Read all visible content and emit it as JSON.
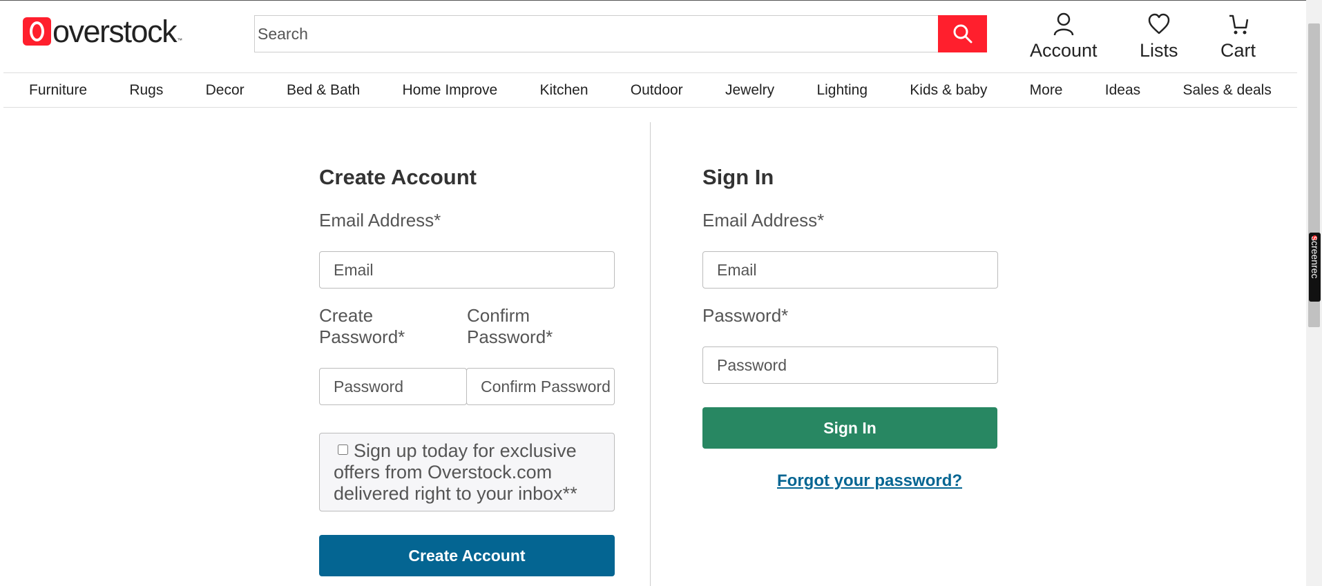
{
  "brand": {
    "logo_text": "overstock",
    "logo_tm": "™",
    "accent_color": "#ff1f2d"
  },
  "search": {
    "placeholder": "Search"
  },
  "header_links": {
    "account": "Account",
    "lists": "Lists",
    "cart": "Cart"
  },
  "nav": {
    "items": [
      "Furniture",
      "Rugs",
      "Decor",
      "Bed & Bath",
      "Home Improve",
      "Kitchen",
      "Outdoor",
      "Jewelry",
      "Lighting",
      "Kids & baby",
      "More",
      "Ideas",
      "Sales & deals"
    ]
  },
  "create_account": {
    "title": "Create Account",
    "email_label": "Email Address*",
    "email_placeholder": "Email",
    "password_label_line1": "Create",
    "password_label_line2": "Password*",
    "confirm_label_line1": "Confirm",
    "confirm_label_line2": "Password*",
    "password_placeholder": "Password",
    "confirm_placeholder": "Confirm Password",
    "optin_text": "Sign up today for exclusive offers from Overstock.com delivered right to your inbox**",
    "optin_checked": false,
    "submit_label": "Create Account",
    "submit_color": "#046592"
  },
  "sign_in": {
    "title": "Sign In",
    "email_label": "Email Address*",
    "email_placeholder": "Email",
    "password_label": "Password*",
    "password_placeholder": "Password",
    "submit_label": "Sign In",
    "submit_color": "#288762",
    "forgot_label": "Forgot your password?"
  },
  "overlay": {
    "recorder_badge": "screenrec"
  }
}
